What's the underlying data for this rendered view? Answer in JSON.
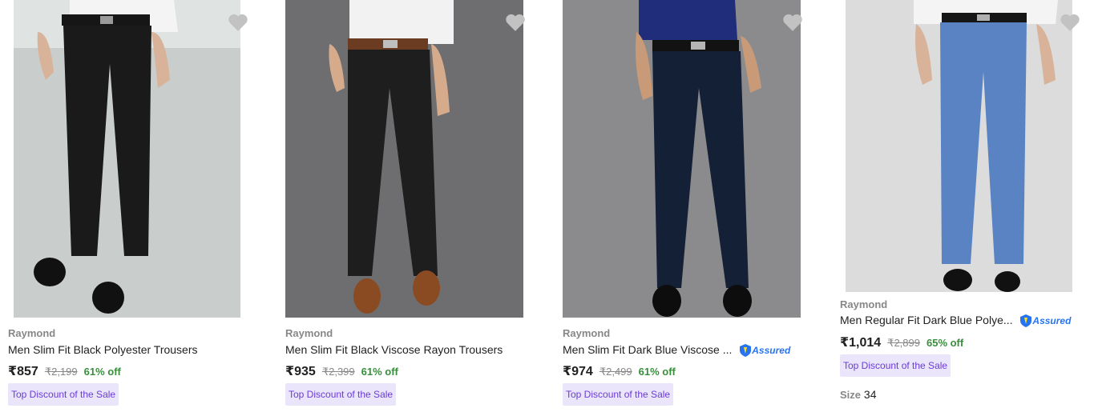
{
  "products": [
    {
      "brand": "Raymond",
      "title": "Men Slim Fit Black Polyester Trousers",
      "price": "₹857",
      "mrp": "₹2,199",
      "discount": "61% off",
      "badge": "Top Discount of the Sale",
      "assured": false,
      "image_icon": "product-photo-black-trousers"
    },
    {
      "brand": "Raymond",
      "title": "Men Slim Fit Black Viscose Rayon Trousers",
      "price": "₹935",
      "mrp": "₹2,399",
      "discount": "61% off",
      "badge": "Top Discount of the Sale",
      "assured": false,
      "image_icon": "product-photo-black-viscose-trousers"
    },
    {
      "brand": "Raymond",
      "title": "Men Slim Fit Dark Blue Viscose ...",
      "price": "₹974",
      "mrp": "₹2,499",
      "discount": "61% off",
      "badge": "Top Discount of the Sale",
      "assured": true,
      "assured_label": "Assured",
      "image_icon": "product-photo-dark-blue-trousers"
    },
    {
      "brand": "Raymond",
      "title": "Men Regular Fit Dark Blue Polye...",
      "price": "₹1,014",
      "mrp": "₹2,899",
      "discount": "65% off",
      "badge": "Top Discount of the Sale",
      "assured": true,
      "assured_label": "Assured",
      "size_label": "Size",
      "size_value": "34",
      "image_icon": "product-photo-blue-trousers"
    }
  ],
  "colors": {
    "discount_green": "#388e3c",
    "badge_bg": "#eae5fb",
    "badge_text": "#6a3cd6",
    "assured_blue": "#2874f0",
    "muted_grey": "#878787",
    "heart_grey": "#c2c2c2"
  }
}
